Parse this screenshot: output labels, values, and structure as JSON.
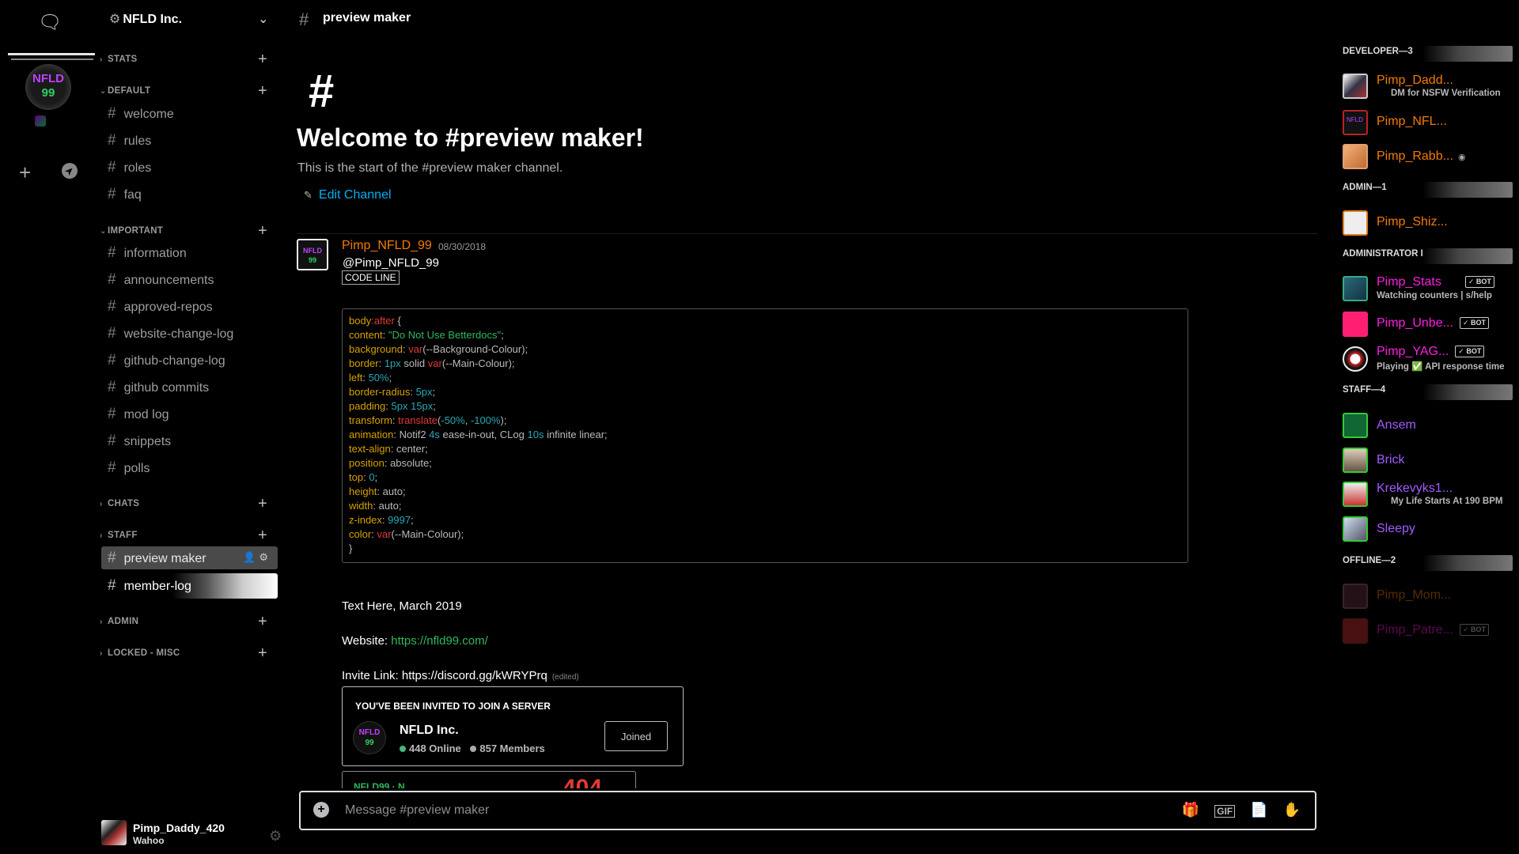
{
  "rail": {
    "chat_icon": "chat-bubble-icon",
    "server_badge": "NFLD 99",
    "add_icon": "plus-icon",
    "explore_icon": "compass-icon"
  },
  "server": {
    "name": "NFLD Inc."
  },
  "categories": {
    "stats": "STATS",
    "default": "DEFAULT",
    "important": "IMPORTANT",
    "chats": "CHATS",
    "staff": "STAFF",
    "admin": "ADMIN",
    "locked": "LOCKED - MISC"
  },
  "channels": {
    "welcome": "welcome",
    "rules": "rules",
    "roles": "roles",
    "faq": "faq",
    "information": "information",
    "announcements": "announcements",
    "approved_repos": "approved-repos",
    "website_change_log": "website-change-log",
    "github_change_log": "github-change-log",
    "github_commits": "github commits",
    "mod_log": "mod log",
    "snippets": "snippets",
    "polls": "polls",
    "preview_maker": "preview maker",
    "member_log": "member-log"
  },
  "user": {
    "name": "Pimp_Daddy_420",
    "status": "Wahoo"
  },
  "header": {
    "channel": "preview maker"
  },
  "welcome": {
    "title": "Welcome to #preview maker!",
    "subtitle": "This is the start of the #preview maker channel.",
    "edit": "Edit Channel"
  },
  "message": {
    "author": "Pimp_NFLD_99",
    "timestamp": "08/30/2018",
    "mention": "@Pimp_NFLD_99",
    "code_label": "CODE LINE",
    "text_here": "Text Here, March 2019",
    "website_label": "Website: ",
    "website_url": "https://nfld99.com/",
    "invite_label": "Invite Link: https://discord.gg/kWRYPrq",
    "edited": "(edited)"
  },
  "invite": {
    "heading": "YOU'VE BEEN INVITED TO JOIN A SERVER",
    "name": "NFLD Inc.",
    "online": "448 Online",
    "members": "857 Members",
    "button": "Joined"
  },
  "invite2": {
    "text": "NFLD99 · N",
    "red": "404"
  },
  "composer": {
    "placeholder": "Message #preview maker"
  },
  "members": {
    "developer": "DEVELOPER—3",
    "admin": "ADMIN—1",
    "admin_bot": "ADMINISTRATOR BOT—3",
    "staff": "STAFF—4",
    "offline": "OFFLINE—2",
    "list": {
      "dev1": {
        "name": "Pimp_Dadd...",
        "sub": "DM for NSFW Verification"
      },
      "dev2": {
        "name": "Pimp_NFL..."
      },
      "dev3": {
        "name": "Pimp_Rabb..."
      },
      "adm1": {
        "name": "Pimp_Shiz..."
      },
      "bot1": {
        "name": "Pimp_Stats",
        "sub": "Watching counters | s/help"
      },
      "bot2": {
        "name": "Pimp_Unbe..."
      },
      "bot3": {
        "name": "Pimp_YAG...",
        "sub": "Playing ✅ API response time"
      },
      "staff1": {
        "name": "Ansem"
      },
      "staff2": {
        "name": "Brick"
      },
      "staff3": {
        "name": "Krekevyks1...",
        "sub": "My Life Starts At 190 BPM"
      },
      "staff4": {
        "name": "Sleepy"
      },
      "off1": {
        "name": "Pimp_Mom..."
      },
      "off2": {
        "name": "Pimp_Patre..."
      }
    },
    "bot_tag": "✓ BOT"
  },
  "colors": {
    "orange": "#f47b00",
    "magenta": "#ff1ee0",
    "purple": "#a05cff",
    "link": "#00b0f4",
    "green": "#2fb85a"
  }
}
